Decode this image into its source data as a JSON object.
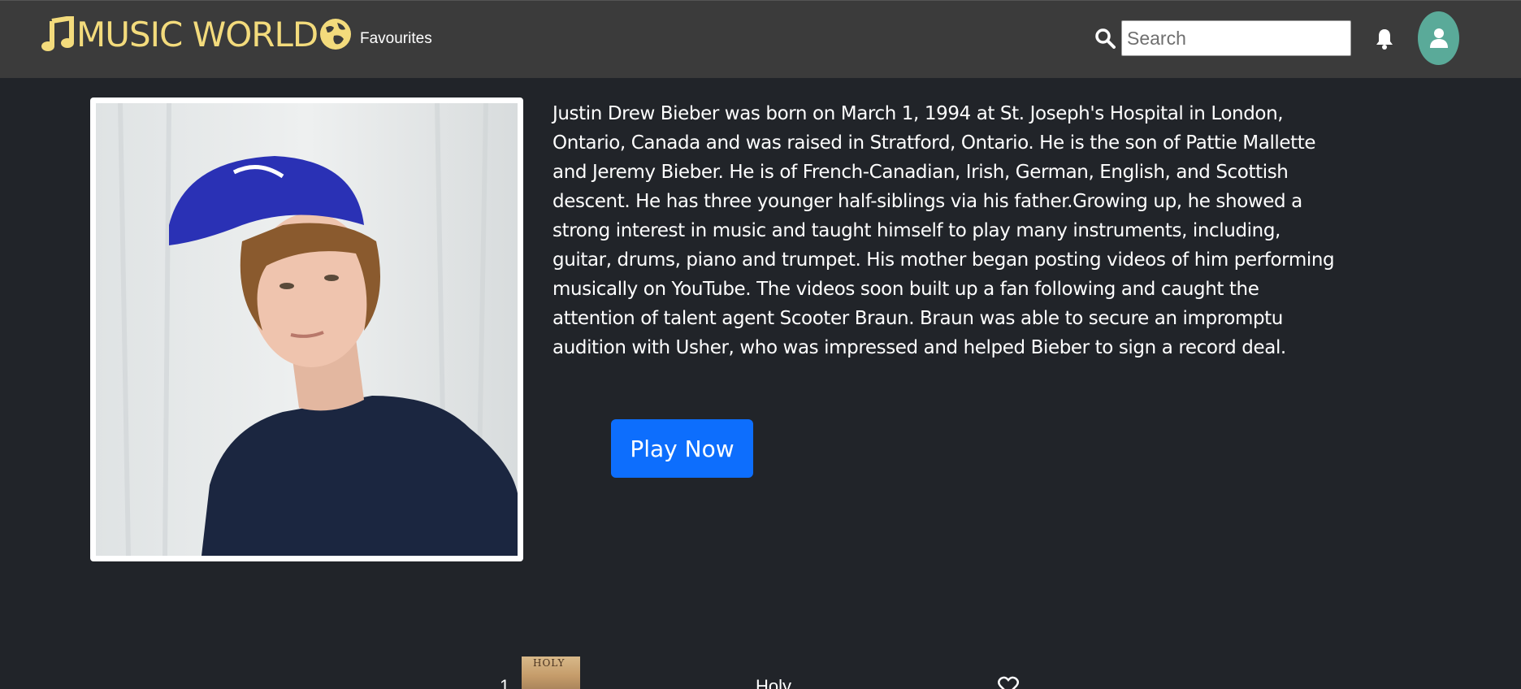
{
  "nav": {
    "logo_text": "MUSIC WORLD",
    "favourites_label": "Favourites",
    "search_placeholder": "Search",
    "search_value": ""
  },
  "icons": {
    "logo_note": "music-note-icon",
    "logo_globe": "globe-icon",
    "search": "search-icon",
    "notifications": "bell-icon",
    "profile": "user-icon",
    "favourite": "heart-icon"
  },
  "colors": {
    "background": "#212429",
    "navbar": "#3b3b3b",
    "logo": "#f3db7c",
    "avatar": "#5aaa99",
    "primary_button": "#0d6efd"
  },
  "artist": {
    "bio": "Justin Drew Bieber was born on March 1, 1994 at St. Joseph's Hospital in London, Ontario, Canada and was raised in Stratford, Ontario. He is the son of Pattie Mallette and Jeremy Bieber. He is of French-Canadian, Irish, German, English, and Scottish descent. He has three younger half-siblings via his father.Growing up, he showed a strong interest in music and taught himself to play many instruments, including, guitar, drums, piano and trumpet. His mother began posting videos of him performing musically on YouTube. The videos soon built up a fan following and caught the attention of talent agent Scooter Braun. Braun was able to secure an impromptu audition with Usher, who was impressed and helped Bieber to sign a record deal.",
    "play_label": "Play Now"
  },
  "tracks": [
    {
      "number": "1",
      "title": "Holy",
      "cover_text": "HOLY"
    }
  ]
}
